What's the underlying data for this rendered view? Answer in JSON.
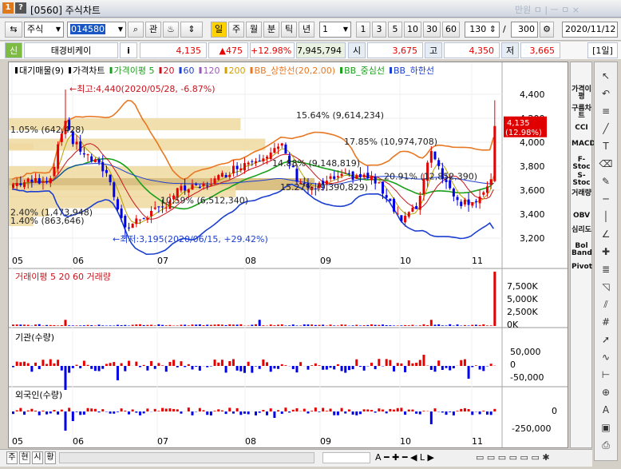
{
  "window": {
    "code": "[0560]",
    "title": "주식차트",
    "icon1": "1",
    "icon2": "?",
    "controls": "만원 ㅁ | ㅡ ㅁ ×"
  },
  "toolbar": {
    "market": "주식",
    "code_value": "014580",
    "btn_relate": "관",
    "periods": [
      "일",
      "주",
      "월",
      "분",
      "틱",
      "년"
    ],
    "interval_value": "1",
    "quick": [
      "1",
      "3",
      "5",
      "10",
      "30",
      "60"
    ],
    "count": "130",
    "slash": "/",
    "total": "300",
    "date": "2020/11/12"
  },
  "info": {
    "tag": "신",
    "name": "태경비케이",
    "i": "i",
    "price": "4,135",
    "change": "▲475",
    "rate": "+12.98%",
    "volume": "7,945,794",
    "open_label": "시",
    "open": "3,675",
    "high_label": "고",
    "high": "4,350",
    "low_label": "저",
    "low": "3,665",
    "period_label": "[1일]"
  },
  "colors": {
    "up": "#e60000",
    "down": "#0000e6",
    "bb": "#e87722",
    "ma5": "#1aa01a",
    "ma20": "#c8141e",
    "ma60": "#1c3fd0",
    "vp": "#f0d9a0",
    "vp_hot": "#d4b56c"
  },
  "price_legend": [
    {
      "text": "대기매물(9)",
      "color": "#000"
    },
    {
      "text": "가격차트",
      "color": "#000"
    },
    {
      "text": "가격이평 5",
      "color": "#1aa01a"
    },
    {
      "text": "20",
      "color": "#c8141e"
    },
    {
      "text": "60",
      "color": "#1c3fd0"
    },
    {
      "text": "120",
      "color": "#9b59b6"
    },
    {
      "text": "200",
      "color": "#d4a000"
    },
    {
      "text": "BB_상한선(20,2.00)",
      "color": "#e87722"
    },
    {
      "text": "BB_중심선",
      "color": "#1aa01a"
    },
    {
      "text": "BB_하한선",
      "color": "#1c3fd0"
    }
  ],
  "annotations": {
    "high": "←최고:4,440(2020/05/28, -6.87%)",
    "low": "←최저:3,195(2020/06/15, +29.42%)",
    "price_tag": "4,135",
    "price_tag_pct": "(12.98%)"
  },
  "volume_profile": [
    "15.64% (9,614,234)",
    "17.85% (10,974,708)",
    "1.05% (642,428)",
    "14.88% (9,148,819)",
    "20.91% (12,852,390)",
    "15.27% (9,390,829)",
    "10.59% (6,512,340)",
    "2.40% (1,473,948)",
    "1.40% (863,646)"
  ],
  "price_axis": [
    "4,400",
    "4,200",
    "4,000",
    "3,800",
    "3,600",
    "3,400",
    "3,200"
  ],
  "month_axis": [
    "05",
    "06",
    "07",
    "08",
    "09",
    "10",
    "11"
  ],
  "volume_panel": {
    "title": "거래이평 5",
    "t2": "20",
    "t3": "60",
    "t4": "거래량",
    "ticks": [
      "7,500K",
      "5,000K",
      "2,500K",
      "0K"
    ]
  },
  "inst_panel": {
    "title": "기관(수량)",
    "ticks": [
      "50,000",
      "0",
      "-50,000"
    ]
  },
  "foreign_panel": {
    "title": "외국인(수량)",
    "ticks": [
      "0",
      "-250,000"
    ]
  },
  "side_buttons": [
    "가격이평",
    "구름차트",
    "CCI",
    "MACD",
    "F-Stoc",
    "S-Stoc",
    "거래량",
    "OBV",
    "심리도",
    "Bol Band",
    "Pivot"
  ],
  "tool_icons": [
    "cursor-icon",
    "undo-icon",
    "all-icon",
    "trend-line-icon",
    "text-icon",
    "eraser-icon",
    "pen-icon",
    "hline-icon",
    "vline-icon",
    "angle-icon",
    "cross-icon",
    "fibo-icon",
    "gann-icon",
    "channel-icon",
    "grid-icon",
    "arrow-icon",
    "wave-icon",
    "ruler-icon",
    "zoom-icon",
    "auto-icon",
    "save-icon",
    "print-icon"
  ],
  "bottom": {
    "tabs": [
      "주",
      "현",
      "시",
      "황"
    ],
    "nav": "A ━ ✚ ━ ◀ L ▶"
  }
}
